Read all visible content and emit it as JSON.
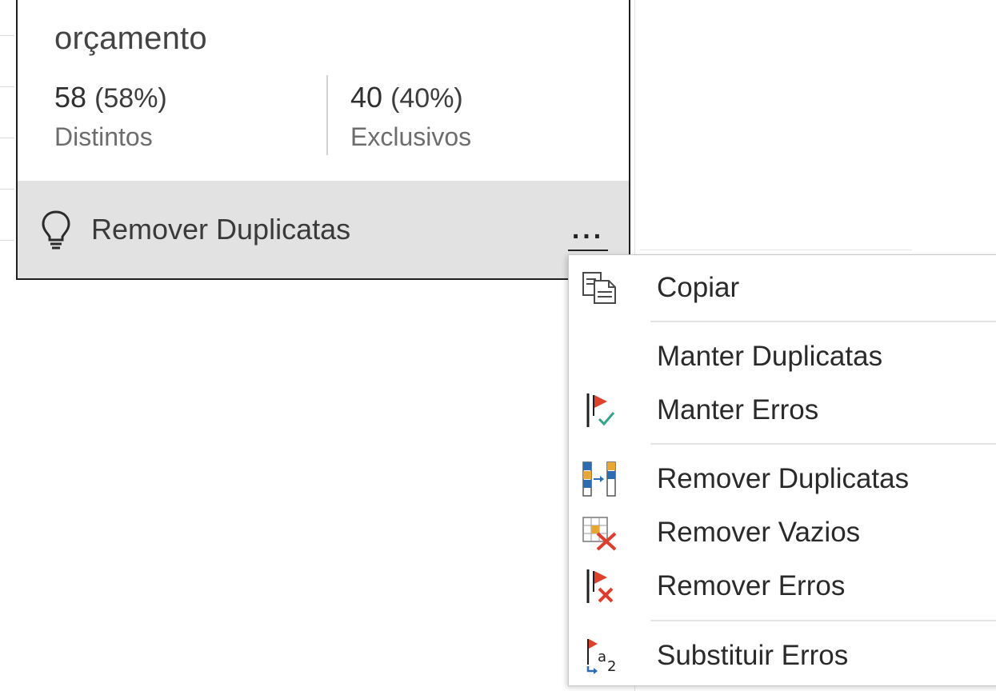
{
  "profile_card": {
    "column_name": "orçamento",
    "distinct": {
      "count": "58",
      "percent": "(58%)",
      "label": "Distintos"
    },
    "unique": {
      "count": "40",
      "percent": "(40%)",
      "label": "Exclusivos"
    },
    "suggestion": {
      "icon": "lightbulb-icon",
      "label": "Remover Duplicatas"
    },
    "more_options": {
      "icon": "ellipsis-icon",
      "label": "..."
    }
  },
  "context_menu": {
    "items": [
      {
        "label": "Copiar",
        "icon": "copy-icon"
      },
      {
        "label": "Manter Duplicatas",
        "icon": ""
      },
      {
        "label": "Manter Erros",
        "icon": "keep-errors-icon"
      },
      {
        "label": "Remover Duplicatas",
        "icon": "remove-duplicates-icon"
      },
      {
        "label": "Remover Vazios",
        "icon": "remove-empty-icon"
      },
      {
        "label": "Remover Erros",
        "icon": "remove-errors-icon"
      },
      {
        "label": "Substituir Erros",
        "icon": "replace-errors-icon"
      }
    ]
  },
  "colors": {
    "flag_red": "#e0402a",
    "check_teal": "#2fa58a",
    "x_red": "#e23b2b",
    "column_blue": "#2b6cb3",
    "column_yellow": "#e8a730",
    "action_bar_bg": "#e2e2e2"
  }
}
